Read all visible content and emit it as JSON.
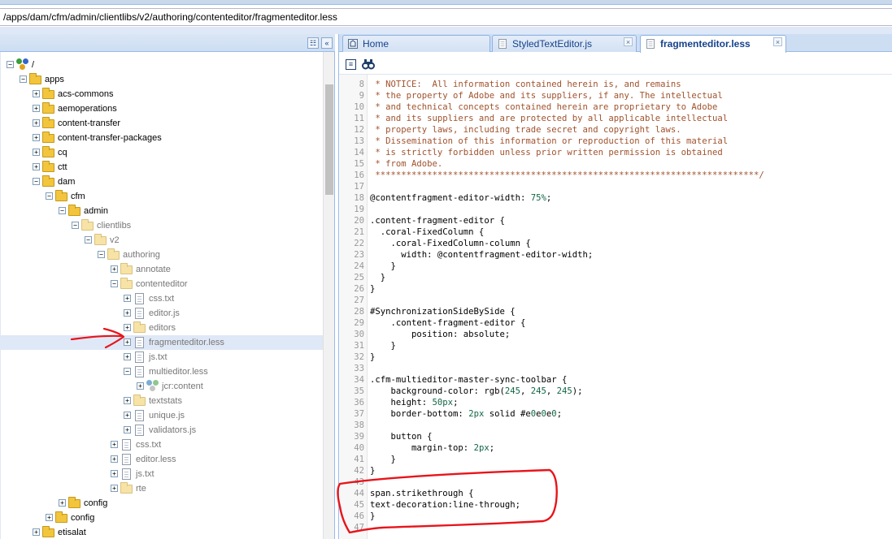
{
  "path": "/apps/dam/cfm/admin/clientlibs/v2/authoring/contenteditor/fragmenteditor.less",
  "tree_header": {
    "collapse_icon": "double-chevron-left-icon",
    "sync_icon": "sync-tree-icon"
  },
  "tree": [
    {
      "label": "/",
      "depth": 0,
      "type": "root",
      "expanded": true
    },
    {
      "label": "apps",
      "depth": 1,
      "type": "folder",
      "expanded": true
    },
    {
      "label": "acs-commons",
      "depth": 2,
      "type": "folder",
      "expanded": false
    },
    {
      "label": "aemoperations",
      "depth": 2,
      "type": "folder",
      "expanded": false
    },
    {
      "label": "content-transfer",
      "depth": 2,
      "type": "folder",
      "expanded": false
    },
    {
      "label": "content-transfer-packages",
      "depth": 2,
      "type": "folder",
      "expanded": false
    },
    {
      "label": "cq",
      "depth": 2,
      "type": "folder",
      "expanded": false
    },
    {
      "label": "ctt",
      "depth": 2,
      "type": "folder",
      "expanded": false
    },
    {
      "label": "dam",
      "depth": 2,
      "type": "folder",
      "expanded": true
    },
    {
      "label": "cfm",
      "depth": 3,
      "type": "folder",
      "expanded": true
    },
    {
      "label": "admin",
      "depth": 4,
      "type": "folder",
      "expanded": true
    },
    {
      "label": "clientlibs",
      "depth": 5,
      "type": "folder",
      "expanded": true,
      "dim": true
    },
    {
      "label": "v2",
      "depth": 6,
      "type": "folder",
      "expanded": true,
      "dim": true
    },
    {
      "label": "authoring",
      "depth": 7,
      "type": "folder",
      "expanded": true,
      "dim": true
    },
    {
      "label": "annotate",
      "depth": 8,
      "type": "folder",
      "expanded": false,
      "dim": true
    },
    {
      "label": "contenteditor",
      "depth": 8,
      "type": "folder",
      "expanded": true,
      "dim": true
    },
    {
      "label": "css.txt",
      "depth": 9,
      "type": "file",
      "expanded": false,
      "dim": true
    },
    {
      "label": "editor.js",
      "depth": 9,
      "type": "file",
      "expanded": false,
      "dim": true
    },
    {
      "label": "editors",
      "depth": 9,
      "type": "folder",
      "expanded": false,
      "dim": true
    },
    {
      "label": "fragmenteditor.less",
      "depth": 9,
      "type": "file",
      "expanded": false,
      "dim": true,
      "selected": true
    },
    {
      "label": "js.txt",
      "depth": 9,
      "type": "file",
      "expanded": false,
      "dim": true
    },
    {
      "label": "multieditor.less",
      "depth": 9,
      "type": "file",
      "expanded": true,
      "dim": true
    },
    {
      "label": "jcr:content",
      "depth": 10,
      "type": "node",
      "expanded": false,
      "dim": true
    },
    {
      "label": "textstats",
      "depth": 9,
      "type": "folder",
      "expanded": false,
      "dim": true
    },
    {
      "label": "unique.js",
      "depth": 9,
      "type": "file",
      "expanded": false,
      "dim": true
    },
    {
      "label": "validators.js",
      "depth": 9,
      "type": "file",
      "expanded": false,
      "dim": true
    },
    {
      "label": "css.txt",
      "depth": 8,
      "type": "file",
      "expanded": false,
      "dim": true
    },
    {
      "label": "editor.less",
      "depth": 8,
      "type": "file",
      "expanded": false,
      "dim": true
    },
    {
      "label": "js.txt",
      "depth": 8,
      "type": "file",
      "expanded": false,
      "dim": true
    },
    {
      "label": "rte",
      "depth": 8,
      "type": "folder",
      "expanded": false,
      "dim": true
    },
    {
      "label": "config",
      "depth": 4,
      "type": "folder",
      "expanded": false
    },
    {
      "label": "config",
      "depth": 3,
      "type": "folder",
      "expanded": false
    },
    {
      "label": "etisalat",
      "depth": 2,
      "type": "folder",
      "expanded": false
    }
  ],
  "tabs": [
    {
      "label": "Home",
      "icon": "home-icon",
      "active": false,
      "closable": false
    },
    {
      "label": "StyledTextEditor.js",
      "icon": "file-icon",
      "active": false,
      "closable": true
    },
    {
      "label": "fragmenteditor.less",
      "icon": "file-icon",
      "active": true,
      "closable": true
    }
  ],
  "toolbar": {
    "format_icon": "format-code-icon",
    "find_icon": "binoculars-find-icon"
  },
  "code_lines": [
    {
      "n": "8",
      "text": " * NOTICE:  All information contained herein is, and remains",
      "cls": "cmt"
    },
    {
      "n": "9",
      "text": " * the property of Adobe and its suppliers, if any. The intellectual",
      "cls": "cmt"
    },
    {
      "n": "10",
      "text": " * and technical concepts contained herein are proprietary to Adobe",
      "cls": "cmt"
    },
    {
      "n": "11",
      "text": " * and its suppliers and are protected by all applicable intellectual",
      "cls": "cmt"
    },
    {
      "n": "12",
      "text": " * property laws, including trade secret and copyright laws.",
      "cls": "cmt"
    },
    {
      "n": "13",
      "text": " * Dissemination of this information or reproduction of this material",
      "cls": "cmt"
    },
    {
      "n": "14",
      "text": " * is strictly forbidden unless prior written permission is obtained",
      "cls": "cmt"
    },
    {
      "n": "15",
      "text": " * from Adobe.",
      "cls": "cmt"
    },
    {
      "n": "16",
      "text": " **************************************************************************/",
      "cls": "cmt"
    },
    {
      "n": "17",
      "text": "",
      "cls": ""
    },
    {
      "n": "18",
      "text": "@contentfragment-editor-width: 75%;",
      "cls": ""
    },
    {
      "n": "19",
      "text": "",
      "cls": ""
    },
    {
      "n": "20",
      "text": ".content-fragment-editor {",
      "cls": ""
    },
    {
      "n": "21",
      "text": "  .coral-FixedColumn {",
      "cls": ""
    },
    {
      "n": "22",
      "text": "    .coral-FixedColumn-column {",
      "cls": ""
    },
    {
      "n": "23",
      "text": "      width: @contentfragment-editor-width;",
      "cls": ""
    },
    {
      "n": "24",
      "text": "    }",
      "cls": ""
    },
    {
      "n": "25",
      "text": "  }",
      "cls": ""
    },
    {
      "n": "26",
      "text": "}",
      "cls": ""
    },
    {
      "n": "27",
      "text": "",
      "cls": ""
    },
    {
      "n": "28",
      "text": "#SynchronizationSideBySide {",
      "cls": ""
    },
    {
      "n": "29",
      "text": "    .content-fragment-editor {",
      "cls": ""
    },
    {
      "n": "30",
      "text": "        position: absolute;",
      "cls": ""
    },
    {
      "n": "31",
      "text": "    }",
      "cls": ""
    },
    {
      "n": "32",
      "text": "}",
      "cls": ""
    },
    {
      "n": "33",
      "text": "",
      "cls": ""
    },
    {
      "n": "34",
      "text": ".cfm-multieditor-master-sync-toolbar {",
      "cls": ""
    },
    {
      "n": "35",
      "text": "    background-color: rgb(245, 245, 245);",
      "cls": ""
    },
    {
      "n": "36",
      "text": "    height: 50px;",
      "cls": ""
    },
    {
      "n": "37",
      "text": "    border-bottom: 2px solid #e0e0e0;",
      "cls": ""
    },
    {
      "n": "38",
      "text": "",
      "cls": ""
    },
    {
      "n": "39",
      "text": "    button {",
      "cls": ""
    },
    {
      "n": "40",
      "text": "        margin-top: 2px;",
      "cls": ""
    },
    {
      "n": "41",
      "text": "    }",
      "cls": ""
    },
    {
      "n": "42",
      "text": "}",
      "cls": ""
    },
    {
      "n": "43",
      "text": "",
      "cls": ""
    },
    {
      "n": "44",
      "text": "span.strikethrough {",
      "cls": ""
    },
    {
      "n": "45",
      "text": "text-decoration:line-through;",
      "cls": ""
    },
    {
      "n": "46",
      "text": "}",
      "cls": ""
    },
    {
      "n": "47",
      "text": "",
      "cls": ""
    }
  ],
  "colors": {
    "annotation_red": "#e8141b",
    "panel_border": "#99bbe8",
    "header_bg": "#cddef3",
    "selected_row": "#dfe8f6"
  }
}
